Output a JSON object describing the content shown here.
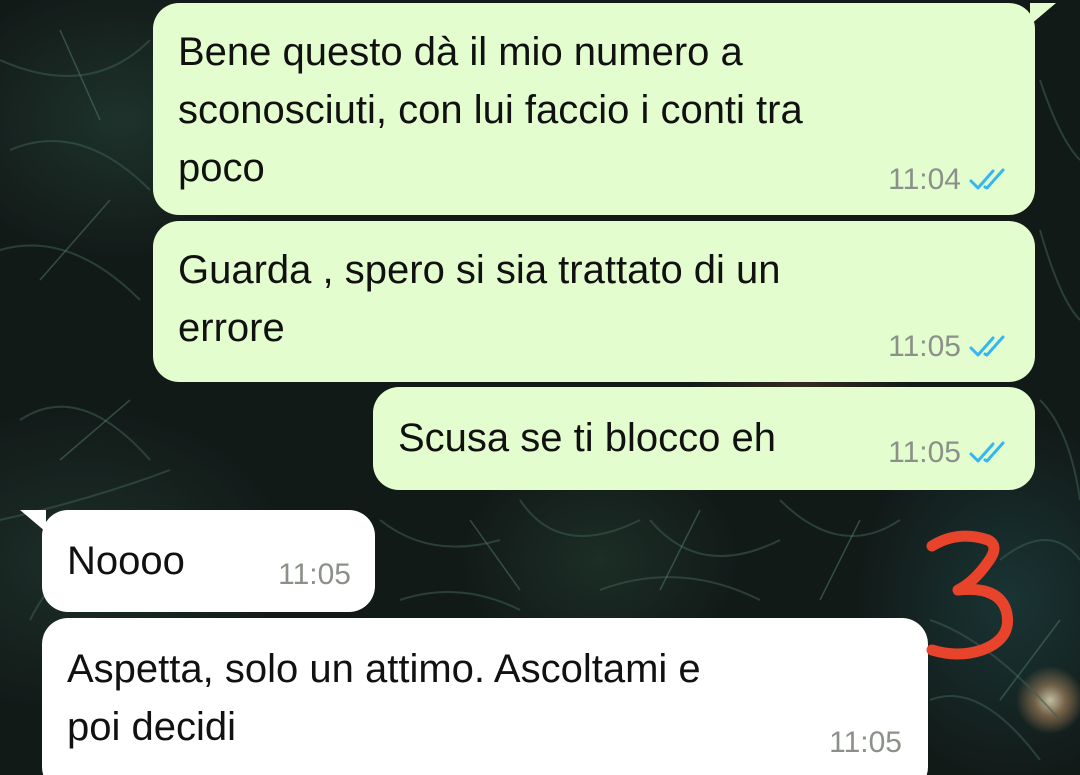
{
  "messages": [
    {
      "direction": "outgoing",
      "text": "Bene questo dà il mio numero a\nsconosciuti, con lui faccio i conti tra\npoco",
      "time": "11:04",
      "status": "read-ticks-icon"
    },
    {
      "direction": "outgoing",
      "text": "Guarda , spero si sia trattato di un\nerrore",
      "time": "11:05",
      "status": "read-ticks-icon"
    },
    {
      "direction": "outgoing",
      "text": "Scusa se ti blocco eh",
      "time": "11:05",
      "status": "read-ticks-icon"
    },
    {
      "direction": "incoming",
      "text": "Noooo",
      "time": "11:05"
    },
    {
      "direction": "incoming",
      "text": "Aspetta, solo un attimo. Ascoltami e\npoi decidi",
      "time": "11:05"
    }
  ],
  "annotation": {
    "text": "3",
    "color": "#e8442c"
  },
  "colors": {
    "outgoing_bubble": "#e3fdcf",
    "incoming_bubble": "#ffffff",
    "read_ticks": "#34b7f1",
    "timestamp": "#8b9189"
  }
}
